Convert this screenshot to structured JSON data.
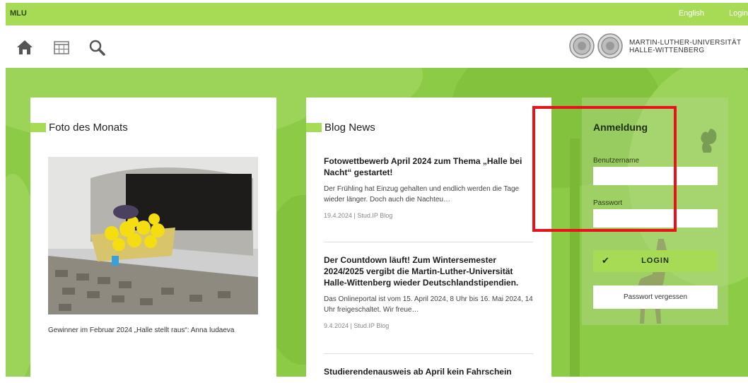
{
  "topbar": {
    "brand": "MLU",
    "language": "English",
    "login": "Login"
  },
  "university": {
    "line1": "MARTIN-LUTHER-UNIVERSITÄT",
    "line2": "HALLE-WITTENBERG"
  },
  "icons": {
    "home": "home-icon",
    "calendar": "calendar-icon",
    "search": "search-icon"
  },
  "photo_of_month": {
    "title": "Foto des Monats",
    "caption": "Gewinner im Februar 2024 „Halle stellt raus“: Anna Iudaeva"
  },
  "blog": {
    "title": "Blog News",
    "posts": [
      {
        "title": "Fotowettbewerb April 2024 zum Thema „Halle bei Nacht“ gestartet!",
        "excerpt": "Der Frühling hat Einzug gehalten und endlich werden die Tage wieder länger. Doch auch die Nachteu…",
        "meta": "19.4.2024 | Stud.IP Blog"
      },
      {
        "title": "Der Countdown läuft! Zum Wintersemester 2024/2025 vergibt die Martin-Luther-Universität Halle-Wittenberg wieder Deutschlandstipendien.",
        "excerpt": "Das Onlineportal ist vom 15. April 2024, 8 Uhr bis 16. Mai 2024, 14 Uhr freigeschaltet. Wir freue…",
        "meta": "9.4.2024 | Stud.IP Blog"
      },
      {
        "title": "Studierendenausweis ab April kein Fahrschein",
        "excerpt": "",
        "meta": ""
      }
    ]
  },
  "login_form": {
    "title": "Anmeldung",
    "username_label": "Benutzername",
    "username_value": "",
    "password_label": "Passwort",
    "password_value": "",
    "login_button": "LOGIN",
    "forgot_button": "Passwort vergessen"
  },
  "colors": {
    "accent": "#a7db55",
    "background": "#8ccb45",
    "highlight": "#e8121b"
  }
}
